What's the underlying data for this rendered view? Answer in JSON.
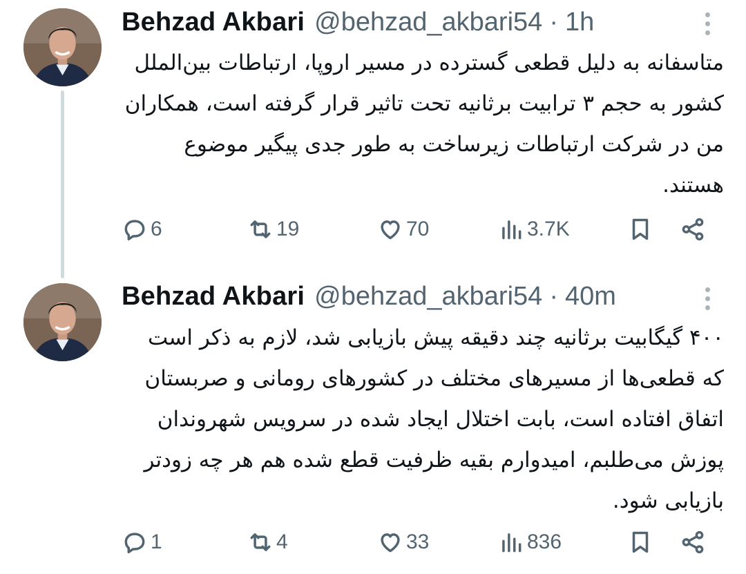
{
  "tweets": [
    {
      "author_name": "Behzad Akbari",
      "handle": "@behzad_akbari54",
      "separator": "·",
      "time": "1h",
      "text": "متاسفانه به دلیل قطعی گسترده در مسیر اروپا، ارتباطات بین‌الملل کشور به حجم ۳ ترابیت برثانیه تحت تاثیر قرار گرفته است، همکاران من در شرکت ارتباطات زیرساخت به طور جدی پیگیر موضوع هستند.",
      "replies": "6",
      "retweets": "19",
      "likes": "70",
      "views": "3.7K"
    },
    {
      "author_name": "Behzad Akbari",
      "handle": "@behzad_akbari54",
      "separator": "·",
      "time": "40m",
      "text": "۴۰۰ گیگابیت برثانیه چند دقیقه پیش بازیابی شد، لازم به ذکر است که قطعی‌ها از مسیرهای مختلف در کشورهای رومانی و صربستان اتفاق افتاده است، بابت اختلال ایجاد شده در سرویس شهروندان پوزش می‌طلبم، امیدوارم بقیه ظرفیت قطع شده هم هر چه زودتر بازیابی شود.",
      "replies": "1",
      "retweets": "4",
      "likes": "33",
      "views": "836"
    }
  ],
  "icons": {
    "reply": "reply-icon",
    "retweet": "retweet-icon",
    "like": "heart-icon",
    "views": "views-icon",
    "bookmark": "bookmark-icon",
    "share": "share-icon",
    "more": "more-vertical-icon"
  },
  "colors": {
    "text": "#0f1419",
    "secondary": "#536471",
    "thread_line": "#cfd9de"
  }
}
